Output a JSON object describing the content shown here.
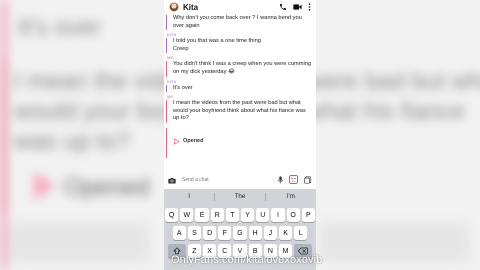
{
  "header": {
    "contact_name": "Kita",
    "icons": [
      "phone-icon",
      "video-icon",
      "more-icon"
    ]
  },
  "messages": [
    {
      "sender": "",
      "side": "kita",
      "text": "Why don't you come back over ? I wanna bend you over again"
    },
    {
      "sender": "KITA",
      "side": "kita",
      "text": "I told you that was a one time thing"
    },
    {
      "sender": "",
      "side": "kita",
      "text": "Creep"
    },
    {
      "sender": "ME",
      "side": "me",
      "text": "You didn't think I was a creep when you were cumming on my dick yesterday 😂"
    },
    {
      "sender": "KITA",
      "side": "kita",
      "text": "It's over"
    },
    {
      "sender": "ME",
      "side": "me",
      "text": "I mean the videos from the past were bad but what would your boyfriend think about what his fiance was up to?"
    }
  ],
  "status": {
    "opened_label": "Opened"
  },
  "composer": {
    "placeholder": "Send a chat"
  },
  "keyboard": {
    "suggestions": [
      "I",
      "The",
      "I'm"
    ],
    "row1": [
      "Q",
      "W",
      "E",
      "R",
      "T",
      "Y",
      "U",
      "I",
      "O",
      "P"
    ],
    "row2": [
      "A",
      "S",
      "D",
      "F",
      "G",
      "H",
      "J",
      "K",
      "L"
    ],
    "row3": [
      "Z",
      "X",
      "C",
      "V",
      "B",
      "N",
      "M"
    ]
  },
  "watermark": "OnlyFans.com/kitalovexoxovib",
  "colors": {
    "kita_accent": "#a06bd6",
    "me_accent": "#f25c80",
    "keyboard_bg": "#d1d3d9"
  }
}
